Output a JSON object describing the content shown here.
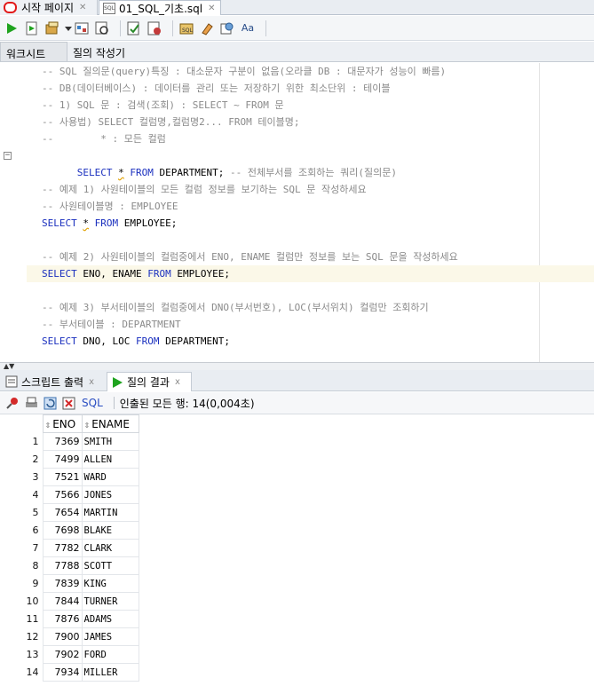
{
  "doc_tabs": [
    {
      "label": "시작 페이지"
    },
    {
      "label": "01_SQL_기초.sql"
    }
  ],
  "sub_tabs": {
    "worksheet": "워크시트",
    "query_builder": "질의 작성기"
  },
  "editor_lines": [
    {
      "type": "comment",
      "text": "-- SQL 질의문(query)특징 : 대소문자 구분이 없음(오라클 DB : 대문자가 성능이 빠름)"
    },
    {
      "type": "comment",
      "text": "-- DB(데이터베이스) : 데이터를 관리 또는 저장하기 위한 최소단위 : 테이블"
    },
    {
      "type": "comment",
      "text": "-- 1) SQL 문 : 검색(조회) : SELECT ~ FROM 문"
    },
    {
      "type": "comment",
      "text": "-- 사용법) SELECT 컬럼명,컬럼명2... FROM 테이블명;"
    },
    {
      "type": "comment",
      "text": "--        * : 모든 컬럼"
    },
    {
      "type": "sql1",
      "text": "SELECT * FROM DEPARTMENT; -- 전체부서를 조회하는 쿼리(질의문)"
    },
    {
      "type": "blank",
      "text": ""
    },
    {
      "type": "comment",
      "text": "-- 예제 1) 사원테이블의 모든 컬럼 정보를 보기하는 SQL 문 작성하세요"
    },
    {
      "type": "comment",
      "text": "-- 사원테이블명 : EMPLOYEE"
    },
    {
      "type": "sql2",
      "text": "SELECT * FROM EMPLOYEE;"
    },
    {
      "type": "blank",
      "text": ""
    },
    {
      "type": "comment",
      "text": "-- 예제 2) 사원테이블의 컬럼중에서 ENO, ENAME 컬럼만 정보를 보는 SQL 문을 작성하세요"
    },
    {
      "type": "sql3",
      "text": "SELECT ENO, ENAME FROM EMPLOYEE;"
    },
    {
      "type": "blank",
      "text": ""
    },
    {
      "type": "comment",
      "text": "-- 예제 3) 부서테이블의 컬럼중에서 DNO(부서번호), LOC(부서위치) 컬럼만 조회하기"
    },
    {
      "type": "comment",
      "text": "-- 부서테이블 : DEPARTMENT"
    },
    {
      "type": "sql4",
      "text": "SELECT DNO, LOC FROM DEPARTMENT;"
    }
  ],
  "sql_tokens": {
    "select": "SELECT",
    "from": "FROM",
    "star": "*",
    "l1_rest": " DEPARTMENT; ",
    "l1_comment": "-- 전체부서를 조회하는 쿼리(질의문)",
    "l2_rest": " EMPLOYEE;",
    "l3_cols": " ENO, ENAME ",
    "l3_rest": " EMPLOYEE;",
    "l4_cols": " DNO, LOC ",
    "l4_rest": " DEPARTMENT;"
  },
  "bottom_tabs": {
    "script_output": "스크립트 출력",
    "query_result": "질의 결과",
    "close": "x"
  },
  "result_toolbar": {
    "sql_label": "SQL",
    "status": "인출된 모든 행: 14(0,004초)"
  },
  "grid": {
    "columns": [
      "ENO",
      "ENAME"
    ],
    "rows": [
      {
        "n": "1",
        "eno": "7369",
        "ename": "SMITH"
      },
      {
        "n": "2",
        "eno": "7499",
        "ename": "ALLEN"
      },
      {
        "n": "3",
        "eno": "7521",
        "ename": "WARD"
      },
      {
        "n": "4",
        "eno": "7566",
        "ename": "JONES"
      },
      {
        "n": "5",
        "eno": "7654",
        "ename": "MARTIN"
      },
      {
        "n": "6",
        "eno": "7698",
        "ename": "BLAKE"
      },
      {
        "n": "7",
        "eno": "7782",
        "ename": "CLARK"
      },
      {
        "n": "8",
        "eno": "7788",
        "ename": "SCOTT"
      },
      {
        "n": "9",
        "eno": "7839",
        "ename": "KING"
      },
      {
        "n": "10",
        "eno": "7844",
        "ename": "TURNER"
      },
      {
        "n": "11",
        "eno": "7876",
        "ename": "ADAMS"
      },
      {
        "n": "12",
        "eno": "7900",
        "ename": "JAMES"
      },
      {
        "n": "13",
        "eno": "7902",
        "ename": "FORD"
      },
      {
        "n": "14",
        "eno": "7934",
        "ename": "MILLER"
      }
    ]
  },
  "colors": {
    "keyword": "#1a2fbe",
    "comment": "#8a8a8a",
    "highlight_line": "#fbf8e8",
    "run_green": "#1fa31f"
  },
  "icons": [
    "oracle-icon",
    "sql-file-icon",
    "run-statement-icon",
    "run-script-icon",
    "commit-icon",
    "explain-icon",
    "autotrace-icon",
    "rollback-icon",
    "sql-tuning-icon",
    "eraser-icon",
    "history-icon",
    "text-format-icon",
    "pin-icon",
    "print-icon",
    "refresh-icon",
    "delete-icon",
    "sort-icon",
    "fold-icon"
  ]
}
